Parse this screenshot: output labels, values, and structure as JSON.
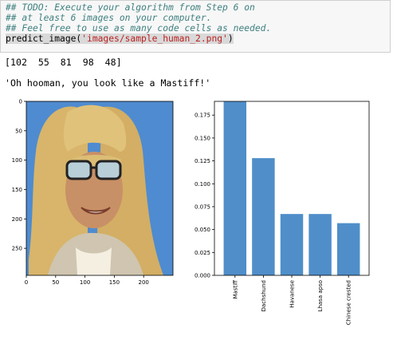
{
  "input_cell": {
    "comment_lines": [
      "## TODO: Execute your algorithm from Step 6 on",
      "## at least 6 images on your computer.",
      "## Feel free to use as many code cells as needed."
    ],
    "call": {
      "func": "predict_image(",
      "arg": "'images/sample_human_2.png'",
      "close": ")"
    }
  },
  "outputs": {
    "array_text": "[102  55  81  98  48]",
    "message_text": "'Oh hooman, you look like a Mastiff!'"
  },
  "image_plot": {
    "x_ticks": [
      "0",
      "50",
      "100",
      "150",
      "200"
    ],
    "y_ticks": [
      "0",
      "50",
      "100",
      "150",
      "200",
      "250"
    ],
    "colors": {
      "background": "#4f8bd0",
      "hair": "#d8b56a"
    }
  },
  "chart_data": {
    "type": "bar",
    "categories": [
      "Mastiff",
      "Dachshund",
      "Havanese",
      "Lhasa apso",
      "Chinese crested"
    ],
    "values": [
      0.19,
      0.128,
      0.067,
      0.067,
      0.057
    ],
    "ylim": [
      0,
      0.19
    ],
    "yticks": [
      "0.000",
      "0.025",
      "0.050",
      "0.075",
      "0.100",
      "0.125",
      "0.150",
      "0.175"
    ],
    "bar_color": "#4f8ec9"
  }
}
